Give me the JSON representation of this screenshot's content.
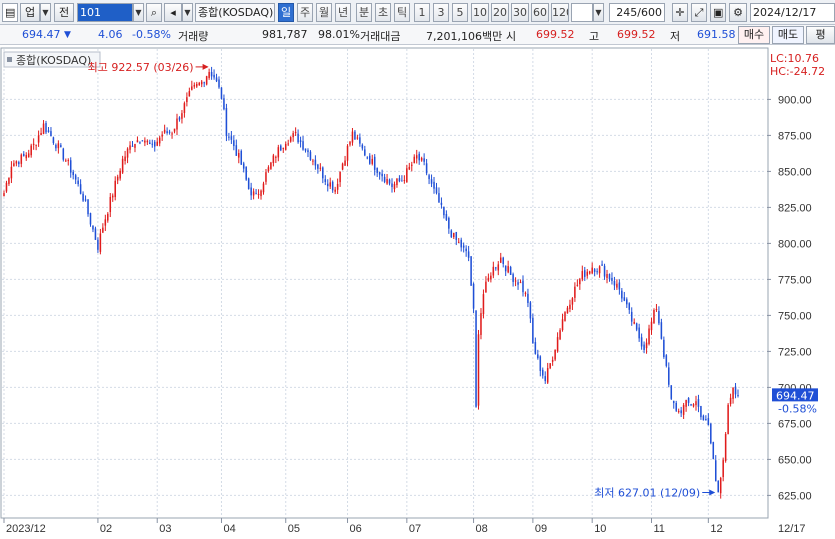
{
  "toolbar": {
    "market_label": "업",
    "market_type_label": "전",
    "code_value": "101",
    "index_name": "종합(KOSDAQ)",
    "periods": [
      "일",
      "주",
      "월",
      "년",
      "분",
      "초",
      "틱"
    ],
    "active_period": "일",
    "intervals": [
      "1",
      "3",
      "5",
      "10",
      "20",
      "30",
      "60",
      "120"
    ],
    "count_value": "245/600",
    "date_value": "2024/12/17"
  },
  "quote": {
    "price": "694.47",
    "change": "4.06",
    "change_pct": "-0.58%",
    "volume_label": "거래량",
    "volume": "981,787",
    "volume_ratio": "98.01%",
    "amount_label": "거래대금",
    "amount": "7,201,106백만",
    "open_label": "시",
    "open": "699.52",
    "high_label": "고",
    "high": "699.52",
    "low_label": "저",
    "low": "691.58",
    "buy_label": "매수",
    "sell_label": "매도",
    "eval_label": "평"
  },
  "chart_data": {
    "type": "candlestick",
    "series_name": "종합(KOSDAQ)",
    "ylim": [
      610,
      935
    ],
    "yticks": [
      625,
      650,
      675,
      700,
      725,
      750,
      775,
      800,
      825,
      850,
      875,
      900
    ],
    "y_tick_labels": [
      "625.00",
      "650.00",
      "675.00",
      "700.00",
      "725.00",
      "750.00",
      "775.00",
      "800.00",
      "825.00",
      "850.00",
      "875.00",
      "900.00"
    ],
    "x_labels": [
      {
        "label": "2023/12",
        "index": 0
      },
      {
        "label": "02",
        "index": 38
      },
      {
        "label": "03",
        "index": 62
      },
      {
        "label": "04",
        "index": 88
      },
      {
        "label": "05",
        "index": 114
      },
      {
        "label": "06",
        "index": 139
      },
      {
        "label": "07",
        "index": 163
      },
      {
        "label": "08",
        "index": 190
      },
      {
        "label": "09",
        "index": 214
      },
      {
        "label": "10",
        "index": 238
      },
      {
        "label": "11",
        "index": 262
      },
      {
        "label": "12",
        "index": 285
      }
    ],
    "last_date_label": "12/17",
    "anchors": [
      [
        0,
        835
      ],
      [
        3,
        855
      ],
      [
        8,
        860
      ],
      [
        12,
        868
      ],
      [
        16,
        882
      ],
      [
        20,
        872
      ],
      [
        25,
        858
      ],
      [
        28,
        848
      ],
      [
        32,
        832
      ],
      [
        35,
        815
      ],
      [
        38,
        798
      ],
      [
        40,
        812
      ],
      [
        44,
        835
      ],
      [
        48,
        858
      ],
      [
        52,
        870
      ],
      [
        56,
        874
      ],
      [
        60,
        866
      ],
      [
        64,
        876
      ],
      [
        68,
        878
      ],
      [
        72,
        892
      ],
      [
        76,
        906
      ],
      [
        80,
        912
      ],
      [
        83,
        920
      ],
      [
        85,
        916
      ],
      [
        88,
        902
      ],
      [
        90,
        878
      ],
      [
        93,
        868
      ],
      [
        96,
        855
      ],
      [
        99,
        838
      ],
      [
        102,
        832
      ],
      [
        106,
        848
      ],
      [
        110,
        862
      ],
      [
        114,
        872
      ],
      [
        118,
        875
      ],
      [
        122,
        866
      ],
      [
        126,
        856
      ],
      [
        130,
        845
      ],
      [
        134,
        838
      ],
      [
        137,
        856
      ],
      [
        141,
        876
      ],
      [
        145,
        865
      ],
      [
        149,
        856
      ],
      [
        153,
        848
      ],
      [
        157,
        840
      ],
      [
        161,
        844
      ],
      [
        164,
        852
      ],
      [
        167,
        860
      ],
      [
        170,
        854
      ],
      [
        173,
        840
      ],
      [
        176,
        828
      ],
      [
        179,
        814
      ],
      [
        182,
        804
      ],
      [
        185,
        798
      ],
      [
        188,
        790
      ],
      [
        190,
        752
      ],
      [
        191,
        685
      ],
      [
        192,
        740
      ],
      [
        194,
        765
      ],
      [
        197,
        780
      ],
      [
        201,
        790
      ],
      [
        205,
        778
      ],
      [
        209,
        772
      ],
      [
        212,
        760
      ],
      [
        214,
        730
      ],
      [
        216,
        718
      ],
      [
        219,
        705
      ],
      [
        222,
        722
      ],
      [
        226,
        748
      ],
      [
        230,
        765
      ],
      [
        234,
        778
      ],
      [
        238,
        784
      ],
      [
        242,
        782
      ],
      [
        246,
        775
      ],
      [
        249,
        768
      ],
      [
        252,
        755
      ],
      [
        256,
        738
      ],
      [
        259,
        728
      ],
      [
        262,
        745
      ],
      [
        264,
        756
      ],
      [
        266,
        735
      ],
      [
        268,
        712
      ],
      [
        270,
        690
      ],
      [
        273,
        683
      ],
      [
        276,
        688
      ],
      [
        280,
        690
      ],
      [
        283,
        678
      ],
      [
        285,
        672
      ],
      [
        287,
        650
      ],
      [
        288,
        634
      ],
      [
        289,
        628
      ],
      [
        291,
        652
      ],
      [
        293,
        685
      ],
      [
        295,
        697
      ],
      [
        297,
        694
      ]
    ],
    "n_candles": 298,
    "last_close": 694.47,
    "last_change_pct": "-0.58%",
    "high_annotation": {
      "text": "최고 922.57 (03/26)",
      "value": 922.57,
      "index": 84
    },
    "low_annotation": {
      "text": "최저 627.01 (12/09)",
      "value": 627.01,
      "index": 289
    },
    "right_top_labels": [
      "LC:10.76",
      "HC:-24.72"
    ],
    "up_color": "#e01b1b",
    "down_color": "#1f4fd6"
  },
  "legend": {
    "label": "종합(KOSDAQ)"
  }
}
